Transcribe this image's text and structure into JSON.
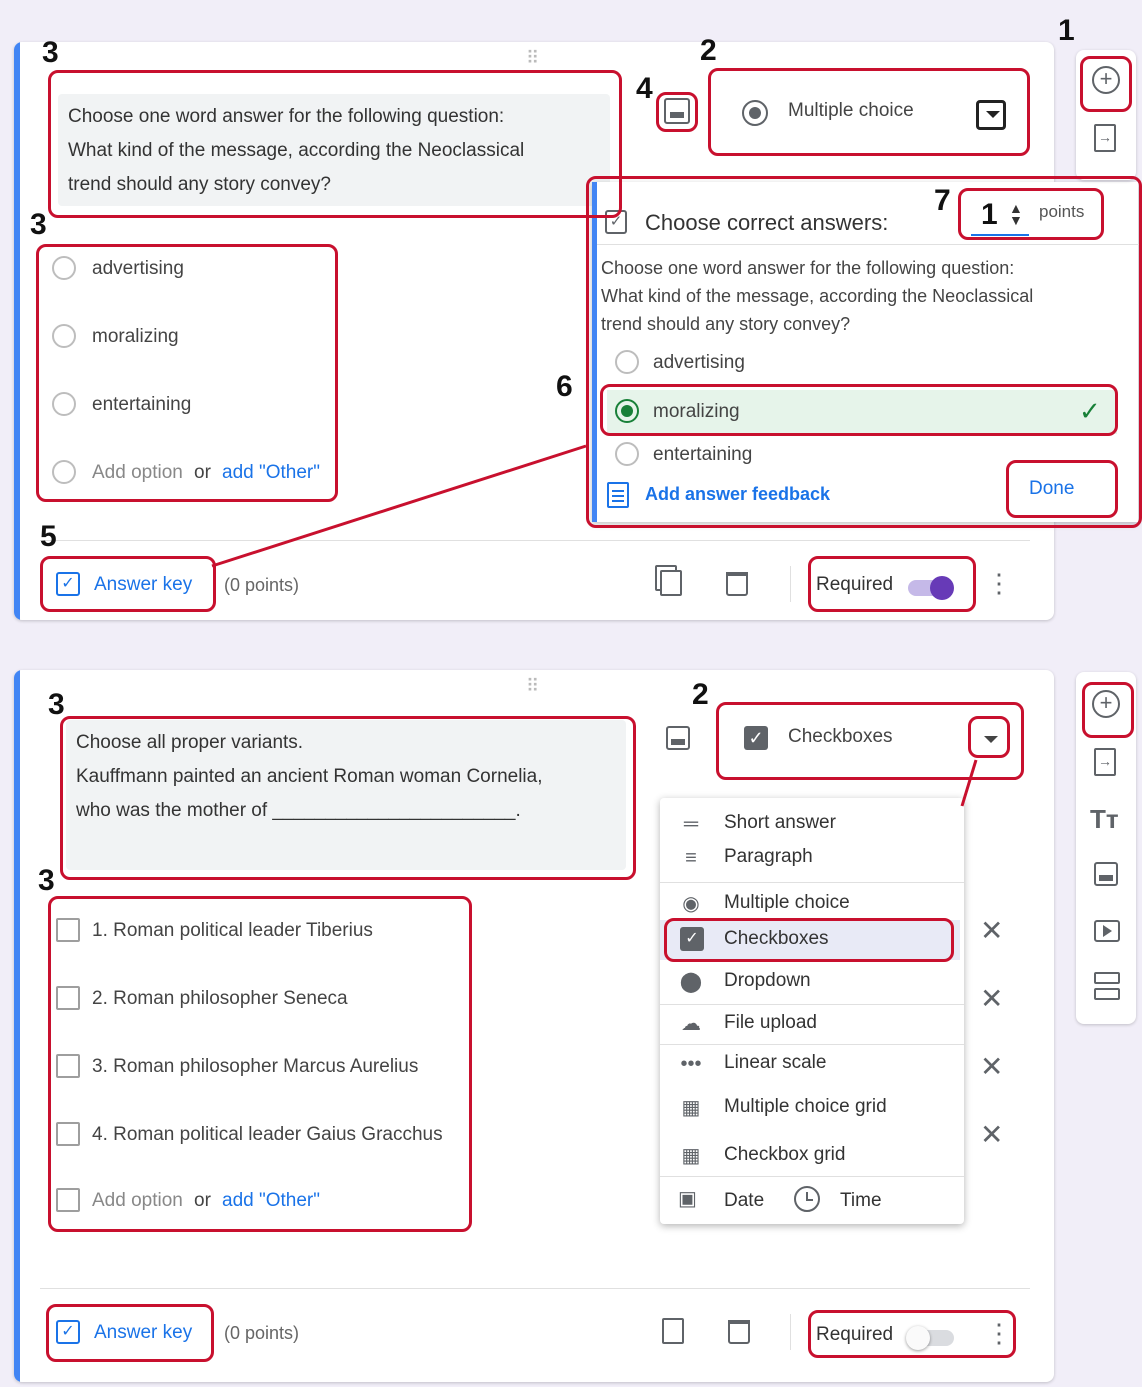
{
  "annotations": {
    "n1": "1",
    "n2": "2",
    "n3": "3",
    "n4": "4",
    "n5": "5",
    "n6": "6",
    "n7": "7"
  },
  "q1": {
    "drag_handle": "⠿",
    "question_lines": [
      "Choose one word answer for the following question:",
      "What kind of the message, according the Neoclassical",
      "trend should any story convey?"
    ],
    "type_label": "Multiple choice",
    "options": [
      "advertising",
      "moralizing",
      "entertaining"
    ],
    "add_option": "Add option",
    "or": "or",
    "add_other": "add \"Other\"",
    "answer_key": "Answer key",
    "points": "(0 points)",
    "required": "Required"
  },
  "popup": {
    "title": "Choose correct answers:",
    "points_value": "1",
    "points_label": "points",
    "question_lines": [
      "Choose one word answer for the following question:",
      "What kind of the message, according the Neoclassical",
      "trend should any story convey?"
    ],
    "options": [
      "advertising",
      "moralizing",
      "entertaining"
    ],
    "selected_check": "✓",
    "feedback": "Add answer feedback",
    "done": "Done"
  },
  "q2": {
    "drag_handle": "⠿",
    "question_lines": [
      "Choose all proper variants.",
      "Kauffmann painted an ancient Roman woman Cornelia,",
      "who was the mother of _______________________."
    ],
    "type_label": "Checkboxes",
    "options": [
      "1. Roman political leader  Tiberius",
      "2. Roman philosopher Seneca",
      "3. Roman philosopher Marcus Aurelius",
      "4. Roman political leader  Gaius Gracchus"
    ],
    "add_option": "Add option",
    "or": "or",
    "add_other": "add \"Other\"",
    "answer_key": "Answer key",
    "points": "(0 points)",
    "required": "Required"
  },
  "type_menu": {
    "items": [
      {
        "label": "Short answer",
        "icon": "short-answer-icon"
      },
      {
        "label": "Paragraph",
        "icon": "paragraph-icon"
      },
      {
        "label": "Multiple choice",
        "icon": "radio-icon"
      },
      {
        "label": "Checkboxes",
        "icon": "checkbox-icon"
      },
      {
        "label": "Dropdown",
        "icon": "dropdown-icon"
      },
      {
        "label": "File upload",
        "icon": "cloud-upload-icon"
      },
      {
        "label": "Linear scale",
        "icon": "linear-scale-icon"
      },
      {
        "label": "Multiple choice grid",
        "icon": "grid-icon"
      },
      {
        "label": "Checkbox grid",
        "icon": "grid-icon"
      }
    ],
    "date": "Date",
    "time": "Time"
  },
  "colors": {
    "accent": "#4285f4",
    "annotation": "#c8102e",
    "purple": "#673ab7",
    "green": "#188038"
  }
}
